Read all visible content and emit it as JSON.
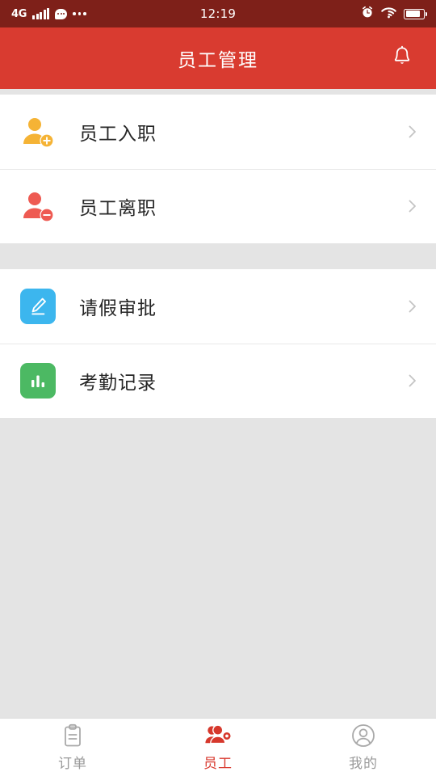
{
  "theme": {
    "statusbar_bg": "#7E2019",
    "header_bg": "#D93B30",
    "page_bg": "#E4E4E4",
    "card_bg": "#FFFFFF",
    "accent": "#D93B30",
    "label_color": "#262626",
    "muted_color": "#9A9A9A"
  },
  "statusbar": {
    "network": "4G",
    "signal_icon": "signal-bars-icon",
    "chat_icon": "chat-bubble-icon",
    "more_icon": "ellipsis-icon",
    "time": "12:19",
    "alarm_icon": "alarm-clock-icon",
    "wifi_icon": "wifi-icon",
    "battery_icon": "battery-icon",
    "battery_level": "82%"
  },
  "header": {
    "title": "员工管理",
    "notification_icon": "bell-icon"
  },
  "groups": [
    {
      "items": [
        {
          "label": "员工入职",
          "icon": "person-add-icon",
          "icon_color": "#F5B335",
          "chevron": "chevron-right-icon"
        },
        {
          "label": "员工离职",
          "icon": "person-remove-icon",
          "icon_color": "#EE5A52",
          "chevron": "chevron-right-icon"
        }
      ]
    },
    {
      "items": [
        {
          "label": "请假审批",
          "icon": "pencil-edit-icon",
          "icon_color": "#3CB6EE",
          "chevron": "chevron-right-icon"
        },
        {
          "label": "考勤记录",
          "icon": "bar-chart-icon",
          "icon_color": "#4CB963",
          "chevron": "chevron-right-icon"
        }
      ]
    }
  ],
  "tabbar": {
    "tabs": [
      {
        "label": "订单",
        "icon": "clipboard-icon",
        "active": false
      },
      {
        "label": "员工",
        "icon": "people-gear-icon",
        "active": true
      },
      {
        "label": "我的",
        "icon": "person-circle-icon",
        "active": false
      }
    ]
  }
}
